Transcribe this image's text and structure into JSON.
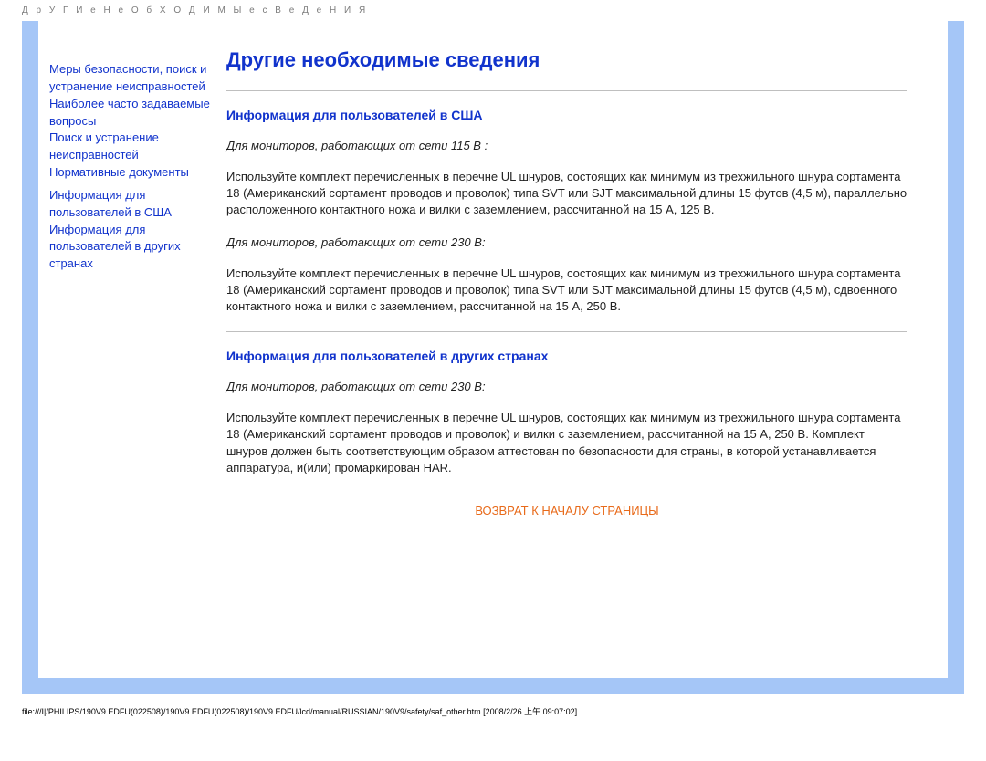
{
  "header_spaced": "Д р У Г И е   Н е О б Х О Д И М Ы е   с В е Д е Н И Я",
  "sidebar": {
    "block1": [
      "Меры безопасности, поиск и устранение неисправностей",
      "Наиболее часто задаваемые вопросы",
      "Поиск и устранение неисправностей",
      "Нормативные документы"
    ],
    "block2": [
      "Информация для пользователей в США",
      "Информация для пользователей в других странах"
    ]
  },
  "main": {
    "title": "Другие необходимые сведения",
    "section1": {
      "heading": "Информация для пользователей в США",
      "p1_label": "Для мониторов, работающих от сети 115 В :",
      "p1_body": "Используйте комплект перечисленных в перечне UL шнуров, состоящих как минимум из трехжильного шнура сортамента 18 (Американский сортамент проводов и проволок) типа SVT или SJT максимальной длины 15 футов (4,5 м), параллельно расположенного контактного ножа и вилки с заземлением, рассчитанной на 15 А, 125 В.",
      "p2_label": "Для мониторов, работающих от сети 230 В:",
      "p2_body": "Используйте комплект перечисленных в перечне UL шнуров, состоящих как минимум из трехжильного шнура сортамента 18 (Американский сортамент проводов и проволок) типа SVT или SJT максимальной длины 15 футов (4,5 м), сдвоенного контактного ножа и вилки с заземлением, рассчитанной на 15 А, 250 В."
    },
    "section2": {
      "heading": "Информация для пользователей в других странах",
      "p1_label": "Для мониторов, работающих от сети 230 В:",
      "p1_body": "Используйте комплект перечисленных в перечне UL шнуров, состоящих как минимум из трехжильного шнура сортамента 18 (Американский сортамент проводов и проволок) и вилки с заземлением, рассчитанной на 15 А, 250 В. Комплект шнуров должен быть соответствующим образом аттестован по безопасности для страны, в которой устанавливается аппаратура, и(или) промаркирован HAR."
    },
    "back_to_top": "ВОЗВРАТ К НАЧАЛУ СТРАНИЦЫ"
  },
  "footer_path": "file:///I|/PHILIPS/190V9 EDFU(022508)/190V9 EDFU(022508)/190V9 EDFU/lcd/manual/RUSSIAN/190V9/safety/saf_other.htm [2008/2/26 上午 09:07:02]"
}
